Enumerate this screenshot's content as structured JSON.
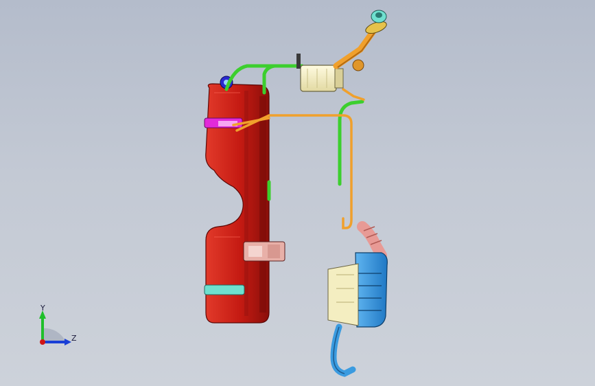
{
  "triad": {
    "y_label": "Y",
    "z_label": "Z",
    "colors": {
      "y": "#1fbf2a",
      "z": "#1a3fd6",
      "origin": "#d01515"
    }
  },
  "parts": [
    {
      "name": "fuel-tank",
      "color": "#c41a12"
    },
    {
      "name": "carbon-canister",
      "color": "#f4eec1"
    },
    {
      "name": "filler-neck",
      "color": "#f0a02c"
    },
    {
      "name": "vapor-lines",
      "color": "#3ccf2e"
    },
    {
      "name": "fuel-lines",
      "color": "#f0a02c"
    },
    {
      "name": "muffler",
      "color": "#3a9be0"
    },
    {
      "name": "exhaust-flex-pipe",
      "color": "#e89a95"
    },
    {
      "name": "tail-pipe",
      "color": "#3a9be0"
    },
    {
      "name": "tank-strap-front",
      "color": "#e22ad8"
    },
    {
      "name": "tank-strap-rear",
      "color": "#6fe0cf"
    }
  ]
}
